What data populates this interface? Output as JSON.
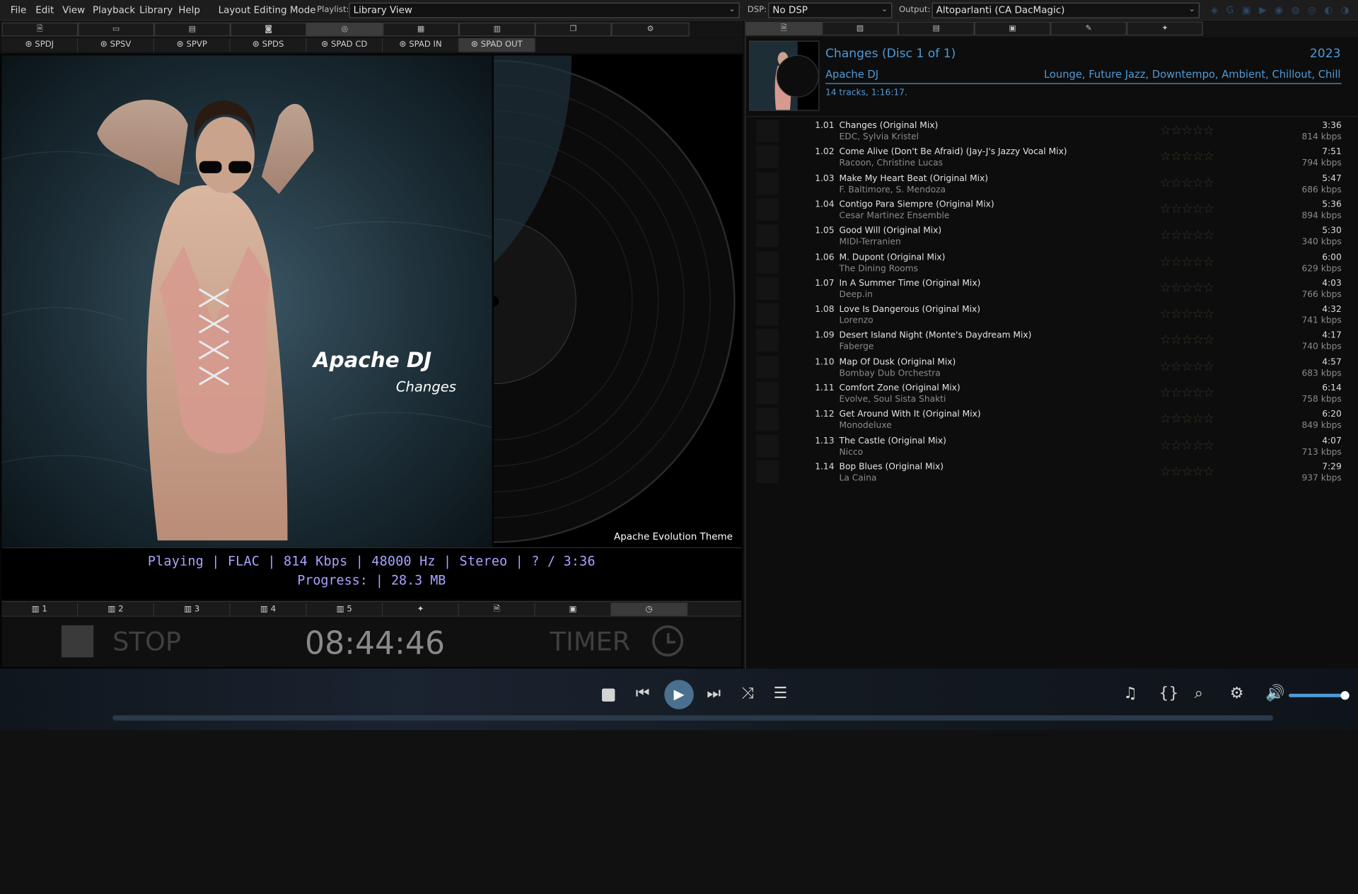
{
  "menu": [
    "File",
    "Edit",
    "View",
    "Playback",
    "Library",
    "Help",
    "Layout Editing Mode"
  ],
  "playlist": {
    "label": "Playlist:",
    "value": "Library View"
  },
  "dsp": {
    "label": "DSP:",
    "value": "No DSP"
  },
  "output": {
    "label": "Output:",
    "value": "Altoparlanti (CA DacMagic)"
  },
  "spad_tabs": [
    "SPDJ",
    "SPSV",
    "SPVP",
    "SPDS",
    "SPAD CD",
    "SPAD IN",
    "SPAD OUT"
  ],
  "cover": {
    "artist": "Apache DJ",
    "album": "Changes",
    "theme": "Apache Evolution Theme"
  },
  "status": {
    "line1": "Playing | FLAC | 814 Kbps | 48000 Hz | Stereo | ? / 3:36",
    "line2": "Progress:  | 28.3 MB"
  },
  "bottom_tabs": [
    "1",
    "2",
    "3",
    "4",
    "5"
  ],
  "control": {
    "stop": "STOP",
    "clock": "08:44:46",
    "timer": "TIMER"
  },
  "album": {
    "title": "Changes (Disc 1 of 1)",
    "year": "2023",
    "artist": "Apache DJ",
    "genres": "Lounge, Future Jazz, Downtempo, Ambient, Chillout, Chill",
    "info": "14 tracks, 1:16:17."
  },
  "tracks": [
    {
      "num": "1.01",
      "title": "Changes (Original Mix)",
      "artist": "EDC, Sylvia Kristel",
      "dur": "3:36",
      "kbps": "814 kbps"
    },
    {
      "num": "1.02",
      "title": "Come Alive (Don't Be Afraid) (Jay-J's Jazzy Vocal Mix)",
      "artist": "Racoon, Christine Lucas",
      "dur": "7:51",
      "kbps": "794 kbps"
    },
    {
      "num": "1.03",
      "title": "Make My Heart Beat (Original Mix)",
      "artist": "F. Baltimore, S. Mendoza",
      "dur": "5:47",
      "kbps": "686 kbps"
    },
    {
      "num": "1.04",
      "title": "Contigo Para Siempre (Original Mix)",
      "artist": "Cesar Martinez Ensemble",
      "dur": "5:36",
      "kbps": "894 kbps"
    },
    {
      "num": "1.05",
      "title": "Good Will (Original Mix)",
      "artist": "MIDI-Terranien",
      "dur": "5:30",
      "kbps": "340 kbps"
    },
    {
      "num": "1.06",
      "title": "M. Dupont (Original Mix)",
      "artist": "The Dining Rooms",
      "dur": "6:00",
      "kbps": "629 kbps"
    },
    {
      "num": "1.07",
      "title": "In A Summer Time (Original Mix)",
      "artist": "Deep.in",
      "dur": "4:03",
      "kbps": "766 kbps"
    },
    {
      "num": "1.08",
      "title": "Love Is Dangerous (Original Mix)",
      "artist": "Lorenzo",
      "dur": "4:32",
      "kbps": "741 kbps"
    },
    {
      "num": "1.09",
      "title": "Desert Island Night (Monte's Daydream Mix)",
      "artist": "Faberge",
      "dur": "4:17",
      "kbps": "740 kbps"
    },
    {
      "num": "1.10",
      "title": "Map Of Dusk (Original Mix)",
      "artist": "Bombay Dub Orchestra",
      "dur": "4:57",
      "kbps": "683 kbps"
    },
    {
      "num": "1.11",
      "title": "Comfort Zone (Original Mix)",
      "artist": "Evolve, Soul Sista Shakti",
      "dur": "6:14",
      "kbps": "758 kbps"
    },
    {
      "num": "1.12",
      "title": "Get Around With It (Original Mix)",
      "artist": "Monodeluxe",
      "dur": "6:20",
      "kbps": "849 kbps"
    },
    {
      "num": "1.13",
      "title": "The Castle (Original Mix)",
      "artist": "Nicco",
      "dur": "4:07",
      "kbps": "713 kbps"
    },
    {
      "num": "1.14",
      "title": "Bop Blues (Original Mix)",
      "artist": "La Caina",
      "dur": "7:29",
      "kbps": "937 kbps"
    }
  ],
  "icons": {
    "stop": "stop-icon",
    "prev": "previous-icon",
    "play": "play-icon",
    "next": "next-icon",
    "shuffle": "shuffle-icon",
    "add": "add-to-queue-icon",
    "lyrics": "lyrics-icon",
    "brackets": "brackets-icon",
    "search": "search-icon",
    "settings": "gear-icon",
    "volume": "volume-icon"
  },
  "colors": {
    "accent": "#4d9ad8",
    "status_text": "#a9a3ff",
    "play_button": "#4a6f8f"
  },
  "volume_level": 1.0,
  "seek_progress": 0.0
}
